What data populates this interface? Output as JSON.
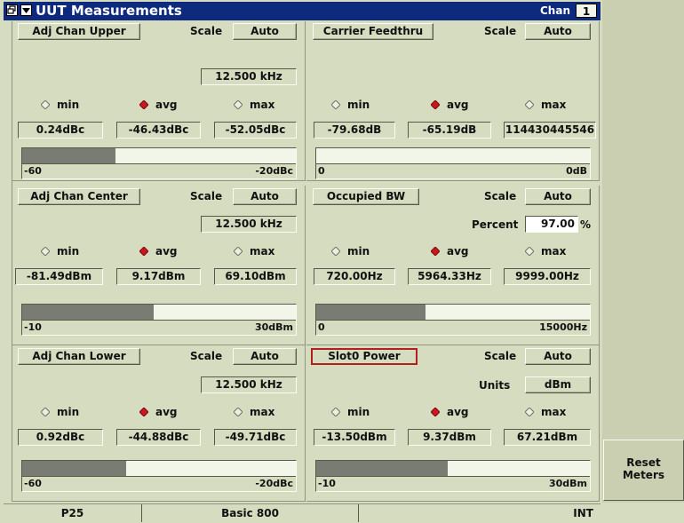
{
  "titlebar": {
    "title": "UUT Measurements",
    "chan_label": "Chan",
    "chan_value": "1"
  },
  "panels": [
    {
      "button": "Adj Chan Upper",
      "scale_label": "Scale",
      "scale_value": "Auto",
      "setting": "12.500 kHz",
      "radios": {
        "min": "min",
        "avg": "avg",
        "max": "max",
        "selected": "avg"
      },
      "values": {
        "min": "0.24dBc",
        "avg": "-46.43dBc",
        "max": "-52.05dBc"
      },
      "bar": {
        "low": "-60",
        "high": "-20dBc",
        "fill_fraction": 0.34
      }
    },
    {
      "button": "Carrier Feedthru",
      "scale_label": "Scale",
      "scale_value": "Auto",
      "radios": {
        "min": "min",
        "avg": "avg",
        "max": "max",
        "selected": "avg"
      },
      "values": {
        "min": "-79.68dB",
        "avg": "-65.19dB",
        "max": "114430445546"
      },
      "bar": {
        "low": "0",
        "high": "0dB",
        "fill_fraction": 0.0
      }
    },
    {
      "button": "Adj Chan Center",
      "scale_label": "Scale",
      "scale_value": "Auto",
      "setting": "12.500 kHz",
      "radios": {
        "min": "min",
        "avg": "avg",
        "max": "max",
        "selected": "avg"
      },
      "values": {
        "min": "-81.49dBm",
        "avg": "9.17dBm",
        "max": "69.10dBm"
      },
      "bar": {
        "low": "-10",
        "high": "30dBm",
        "fill_fraction": 0.48
      }
    },
    {
      "button": "Occupied BW",
      "scale_label": "Scale",
      "scale_value": "Auto",
      "extra_label": "Percent",
      "extra_value": "97.00",
      "extra_unit": "%",
      "radios": {
        "min": "min",
        "avg": "avg",
        "max": "max",
        "selected": "avg"
      },
      "values": {
        "min": "720.00Hz",
        "avg": "5964.33Hz",
        "max": "9999.00Hz"
      },
      "bar": {
        "low": "0",
        "high": "15000Hz",
        "fill_fraction": 0.4
      }
    },
    {
      "button": "Adj Chan Lower",
      "scale_label": "Scale",
      "scale_value": "Auto",
      "setting": "12.500 kHz",
      "radios": {
        "min": "min",
        "avg": "avg",
        "max": "max",
        "selected": "avg"
      },
      "values": {
        "min": "0.92dBc",
        "avg": "-44.88dBc",
        "max": "-49.71dBc"
      },
      "bar": {
        "low": "-60",
        "high": "-20dBc",
        "fill_fraction": 0.38
      }
    },
    {
      "button": "Slot0 Power",
      "scale_label": "Scale",
      "scale_value": "Auto",
      "extra_label": "Units",
      "extra_value": "dBm",
      "radios": {
        "min": "min",
        "avg": "avg",
        "max": "max",
        "selected": "avg"
      },
      "values": {
        "min": "-13.50dBm",
        "avg": "9.37dBm",
        "max": "67.21dBm"
      },
      "bar": {
        "low": "-10",
        "high": "30dBm",
        "fill_fraction": 0.48
      }
    }
  ],
  "softkeys": {
    "reset_line1": "Reset",
    "reset_line2": "Meters"
  },
  "statusbar": {
    "mode": "P25",
    "system": "Basic 800",
    "middle": "",
    "ref": "INT"
  },
  "colors": {
    "background": "#d6dcc0",
    "titlebar": "#0d2a7e",
    "bar_fill": "#7a7c74",
    "selected_outline": "#b0201c",
    "radio_selected": "#c8171d"
  }
}
